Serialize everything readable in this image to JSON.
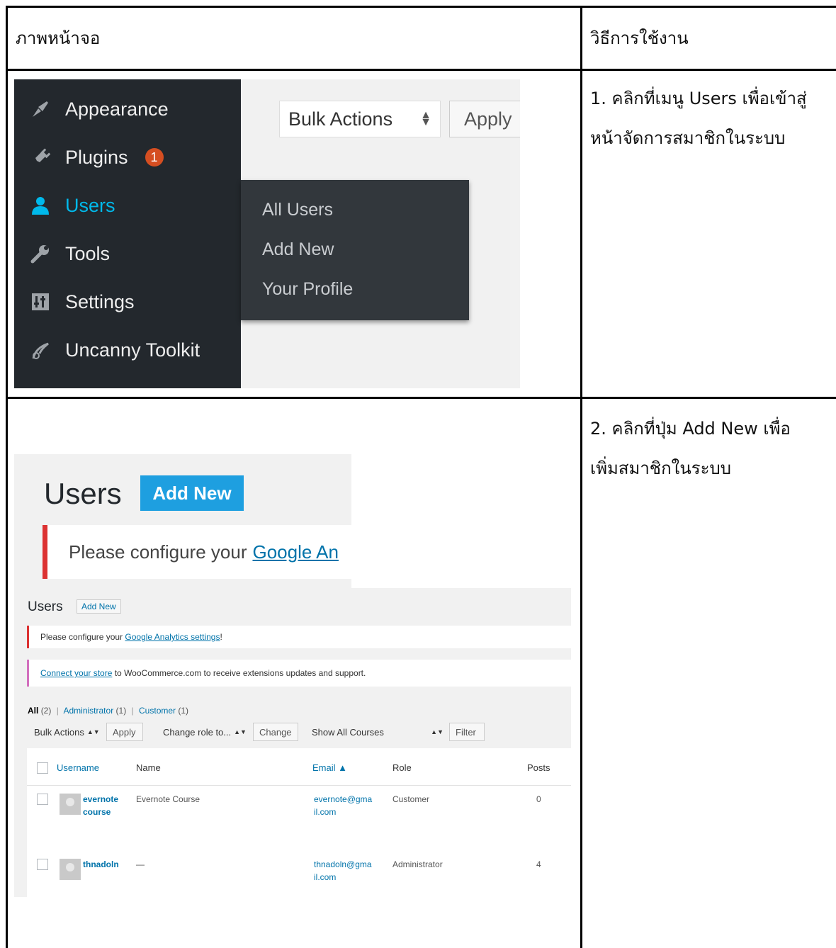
{
  "table": {
    "header_left": "ภาพหน้าจอ",
    "header_right": "วิธีการใช้งาน",
    "row1_text_line1": "1. คลิกที่เมนู Users เพื่อเข้าสู่",
    "row1_text_line2": "หน้าจัดการสมาชิกในระบบ",
    "row2_text_line1": "2. คลิกที่ปุ่ม Add New เพื่อ",
    "row2_text_line2": "เพิ่มสมาชิกในระบบ"
  },
  "shot1": {
    "menu": [
      {
        "label": "Appearance",
        "icon": "brush-icon"
      },
      {
        "label": "Plugins",
        "icon": "plugin-icon",
        "badge": "1"
      },
      {
        "label": "Users",
        "icon": "user-icon"
      },
      {
        "label": "Tools",
        "icon": "wrench-icon"
      },
      {
        "label": "Settings",
        "icon": "settings-icon"
      },
      {
        "label": "Uncanny Toolkit",
        "icon": "toolkit-icon"
      }
    ],
    "submenu": [
      "All Users",
      "Add New",
      "Your Profile"
    ],
    "bulk_actions": "Bulk Actions",
    "apply": "Apply",
    "colors": {
      "sidebar": "#23282d",
      "active": "#00b9eb",
      "badge": "#d54e21"
    }
  },
  "shot2_zoom": {
    "title": "Users",
    "add_new": "Add New",
    "notice_prefix": "Please configure your",
    "notice_link": "Google An"
  },
  "shot2": {
    "title": "Users",
    "add_new": "Add New",
    "notice1_prefix": "Please configure your ",
    "notice1_link": "Google Analytics settings",
    "notice1_suffix": "!",
    "notice2_link": "Connect your store",
    "notice2_suffix": " to WooCommerce.com to receive extensions updates and support.",
    "filter_all": "All",
    "filter_all_count": "(2)",
    "filter_admin": "Administrator",
    "filter_admin_count": "(1)",
    "filter_customer": "Customer",
    "filter_customer_count": "(1)",
    "filter_sep": "|",
    "bulk_actions": "Bulk Actions",
    "apply": "Apply",
    "change_role": "Change role to...",
    "change": "Change",
    "show_courses": "Show All Courses",
    "filter_btn": "Filter",
    "columns": [
      "Username",
      "Name",
      "Email ▲",
      "Role",
      "Posts"
    ],
    "rows": [
      {
        "username_1": "evernote",
        "username_2": "course",
        "name": "Evernote Course",
        "email_1": "evernote@gma",
        "email_2": "il.com",
        "role": "Customer",
        "posts": "0"
      },
      {
        "username_1": "thnadoln",
        "username_2": "",
        "name": "—",
        "email_1": "thnadoln@gma",
        "email_2": "il.com",
        "role": "Administrator",
        "posts": "4"
      }
    ]
  }
}
